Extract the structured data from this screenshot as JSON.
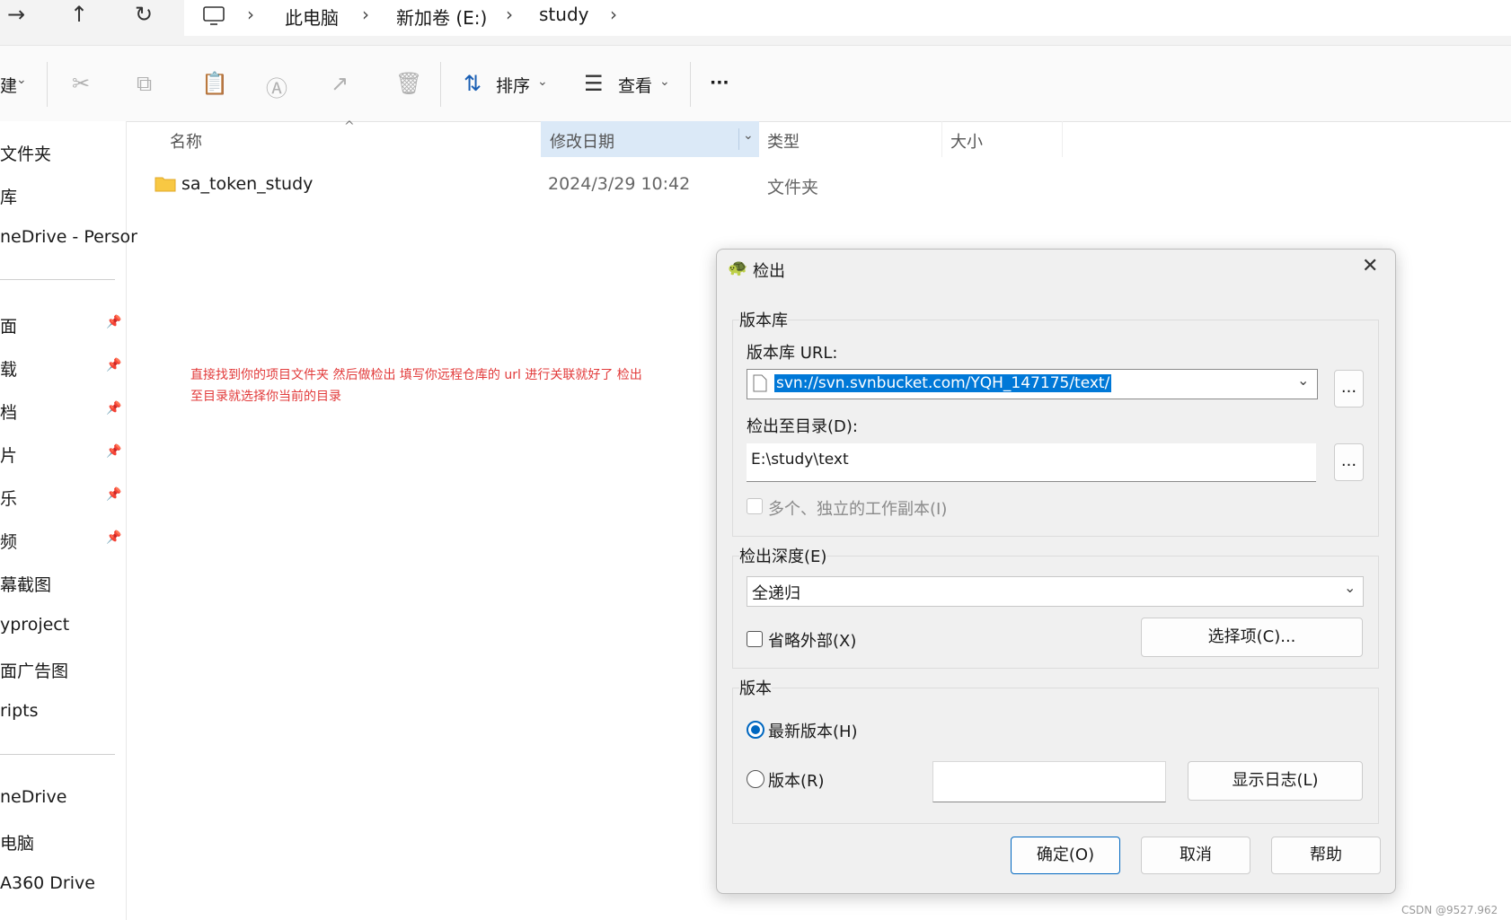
{
  "address_bar": {
    "forward_icon": "arrow-right-icon",
    "up_icon": "arrow-up-icon",
    "refresh_icon": "refresh-icon",
    "computer_icon": "monitor-icon",
    "breadcrumbs": [
      "此电脑",
      "新加卷 (E:)",
      "study"
    ]
  },
  "toolbar": {
    "new_label": "建",
    "sort_label": "排序",
    "view_label": "查看",
    "more_label": "···"
  },
  "sidebar": {
    "items": [
      {
        "label": "文件夹"
      },
      {
        "label": "库"
      },
      {
        "label": "neDrive - Persor"
      },
      {
        "label": "面",
        "pinned": true
      },
      {
        "label": "载",
        "pinned": true
      },
      {
        "label": "档",
        "pinned": true
      },
      {
        "label": "片",
        "pinned": true
      },
      {
        "label": "乐",
        "pinned": true
      },
      {
        "label": "频",
        "pinned": true
      },
      {
        "label": "幕截图"
      },
      {
        "label": "yproject"
      },
      {
        "label": "面广告图"
      },
      {
        "label": "ripts"
      },
      {
        "label": "neDrive"
      },
      {
        "label": "电脑"
      },
      {
        "label": "A360 Drive"
      }
    ]
  },
  "file_list": {
    "columns": {
      "name": "名称",
      "modified": "修改日期",
      "type": "类型",
      "size": "大小"
    },
    "rows": [
      {
        "name": "sa_token_study",
        "modified": "2024/3/29 10:42",
        "type": "文件夹",
        "size": ""
      }
    ]
  },
  "annotation": {
    "line1": "直接找到你的项目文件夹 然后做检出 填写你远程仓库的 url 进行关联就好了 检出",
    "line2": "至目录就选择你当前的目录"
  },
  "dialog": {
    "title": "检出",
    "repo_group": "版本库",
    "url_label": "版本库 URL:",
    "url_value": "svn://svn.svnbucket.com/YQH_147175/text/",
    "browse_label": "...",
    "dir_label": "检出至目录(D):",
    "dir_value": "E:\\study\\text",
    "multi_copy_label": "多个、独立的工作副本(I)",
    "depth_group": "检出深度(E)",
    "depth_value": "全递归",
    "omit_externals_label": "省略外部(X)",
    "options_button": "选择项(C)...",
    "revision_group": "版本",
    "head_label": "最新版本(H)",
    "revision_label": "版本(R)",
    "revision_value": "",
    "show_log_button": "显示日志(L)",
    "ok_button": "确定(O)",
    "cancel_button": "取消",
    "help_button": "帮助"
  },
  "watermark": "CSDN @9527.962"
}
